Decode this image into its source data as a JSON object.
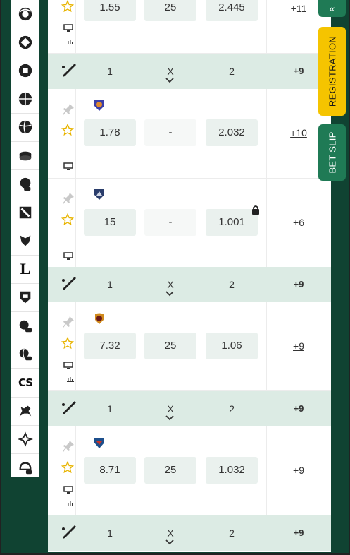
{
  "sidebar": {
    "sports": [
      {
        "icon": "sport-ball-icon-1"
      },
      {
        "icon": "sport-ball-icon-2"
      },
      {
        "icon": "sport-ball-icon-3"
      },
      {
        "icon": "basketball-icon"
      },
      {
        "icon": "volleyball-icon"
      },
      {
        "icon": "ice-hockey-icon"
      },
      {
        "icon": "esports-basketball-icon"
      },
      {
        "icon": "dota-icon"
      },
      {
        "icon": "esports-warrior-icon"
      },
      {
        "icon": "league-icon",
        "text": "L"
      },
      {
        "icon": "world-of-tanks-icon"
      },
      {
        "icon": "esports-football-icon"
      },
      {
        "icon": "esports-volleyball-icon"
      },
      {
        "icon": "counter-strike-icon",
        "text": "CS"
      },
      {
        "icon": "horse-racing-icon"
      },
      {
        "icon": "esports-spiral-icon"
      },
      {
        "icon": "esports-helmet-icon"
      }
    ]
  },
  "header_labels": {
    "one": "1",
    "draw": "X",
    "two": "2"
  },
  "rows": [
    {
      "odds": [
        "1.55",
        "25",
        "2.445"
      ],
      "more": "+11"
    },
    {
      "odds": [
        "1.78",
        "-",
        "2.032"
      ],
      "more": "+10"
    },
    {
      "odds": [
        "15",
        "-",
        "1.001"
      ],
      "more": "+6"
    },
    {
      "odds": [
        "7.32",
        "25",
        "1.06"
      ],
      "more": "+9"
    },
    {
      "odds": [
        "8.71",
        "25",
        "1.032"
      ],
      "more": "+9"
    }
  ],
  "headers": [
    {
      "more": "+9"
    },
    {
      "more": "+9"
    },
    {
      "more": "+9"
    },
    {
      "more": "+9"
    }
  ],
  "tabs": {
    "collapse": "«",
    "registration": "REGISTRATION",
    "bet_slip": "BET SLIP"
  },
  "colors": {
    "brand_green": "#104332",
    "accent_green": "#1f7a55",
    "registration_yellow": "#f5c400",
    "header_row": "#dcebe4",
    "odds_cell": "#eaf1ee",
    "star_yellow": "#e8b400"
  }
}
